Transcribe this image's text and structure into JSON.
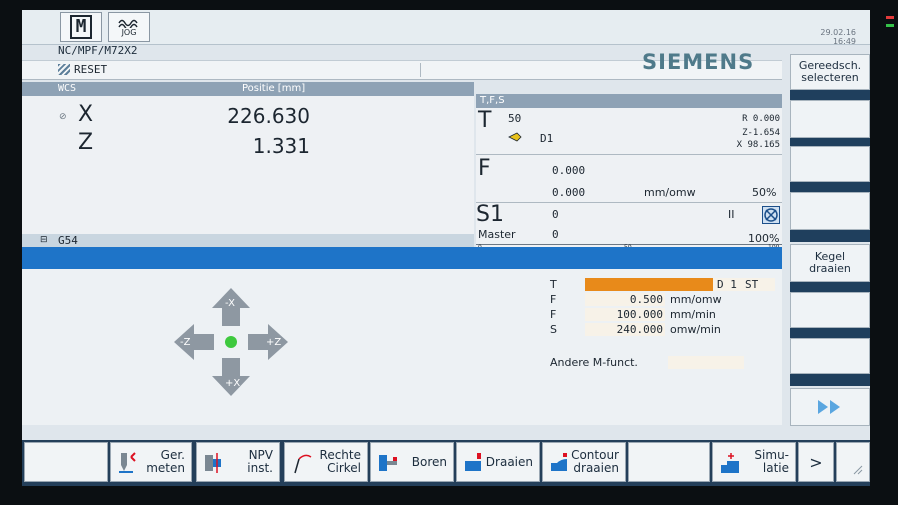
{
  "header": {
    "mode_m": "M",
    "mode_jog": "JOG",
    "date": "29.02.16",
    "time": "16:49",
    "program_path": "NC/MPF/M72X2",
    "reset": "RESET",
    "brand": "SIEMENS"
  },
  "axes": {
    "wcs_label": "WCS",
    "position_header": "Positie [mm]",
    "rows": [
      {
        "name": "X",
        "value": "226.630"
      },
      {
        "name": "Z",
        "value": "1.331"
      }
    ],
    "work_offset": "G54"
  },
  "tfs": {
    "header": "T,F,S",
    "t_label": "T",
    "t_num": "50",
    "d_label": "D1",
    "r": "R 0.000",
    "z": "Z-1.654",
    "x": "X 98.165",
    "f_label": "F",
    "f_val1": "0.000",
    "f_val2": "0.000",
    "f_unit": "mm/omw",
    "f_pct": "50%",
    "s_label": "S1",
    "s_val": "0",
    "s_dir": "II",
    "master_label": "Master",
    "master_val": "0",
    "master_pct": "100%",
    "scale_0": "0",
    "scale_50": "50",
    "scale_100": "100"
  },
  "jog": {
    "minus_x": "-X",
    "plus_x": "+X",
    "minus_z": "-Z",
    "plus_z": "+Z"
  },
  "tech": {
    "t_label": "T",
    "t_d": "D 1",
    "t_st": "ST",
    "f1_label": "F",
    "f1_val": "0.500",
    "f1_unit": "mm/omw",
    "f2_label": "F",
    "f2_val": "100.000",
    "f2_unit": "mm/min",
    "s_label": "S",
    "s_val": "240.000",
    "s_unit": "omw/min",
    "other_m": "Andere M-funct."
  },
  "right_softkeys": {
    "tool_select_1": "Gereedsch.",
    "tool_select_2": "selecteren",
    "taper_1": "Kegel",
    "taper_2": "draaien"
  },
  "bottom_softkeys": {
    "measure_1": "Ger.",
    "measure_2": "meten",
    "zero_1": "NPV",
    "zero_2": "inst.",
    "circle_1": "Rechte",
    "circle_2": "Cirkel",
    "drill": "Boren",
    "turn": "Draaien",
    "contour_1": "Contour",
    "contour_2": "draaien",
    "sim_1": "Simu-",
    "sim_2": "latie",
    "more": ">"
  },
  "colors": {
    "accent_blue": "#1e74c8",
    "header_gray": "#8ea2b5",
    "tool_bar_orange": "#e88a1a",
    "brand": "#4f7a8a"
  }
}
